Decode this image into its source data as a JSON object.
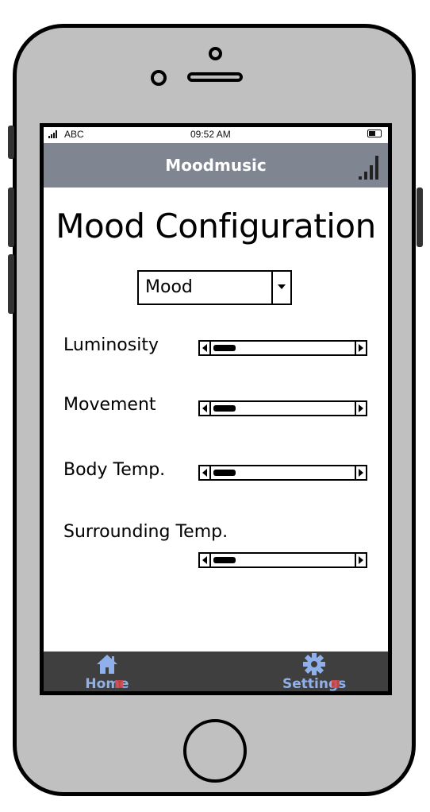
{
  "status_bar": {
    "carrier": "ABC",
    "time": "09:52 AM"
  },
  "nav": {
    "title": "Moodmusic"
  },
  "page": {
    "title": "Mood Configuration"
  },
  "mood_select": {
    "value": "Mood"
  },
  "sliders": [
    {
      "label": "Luminosity"
    },
    {
      "label": "Movement"
    },
    {
      "label": "Body Temp."
    },
    {
      "label": "Surrounding Temp."
    }
  ],
  "tabs": [
    {
      "label": "Home",
      "icon": "home-icon"
    },
    {
      "label": "Settings",
      "icon": "gear-icon"
    }
  ],
  "colors": {
    "nav_background": "#7f8591",
    "tab_background": "#3f3f3f",
    "tab_accent": "#8fb0ea",
    "phone_body": "#c0c0c0"
  }
}
